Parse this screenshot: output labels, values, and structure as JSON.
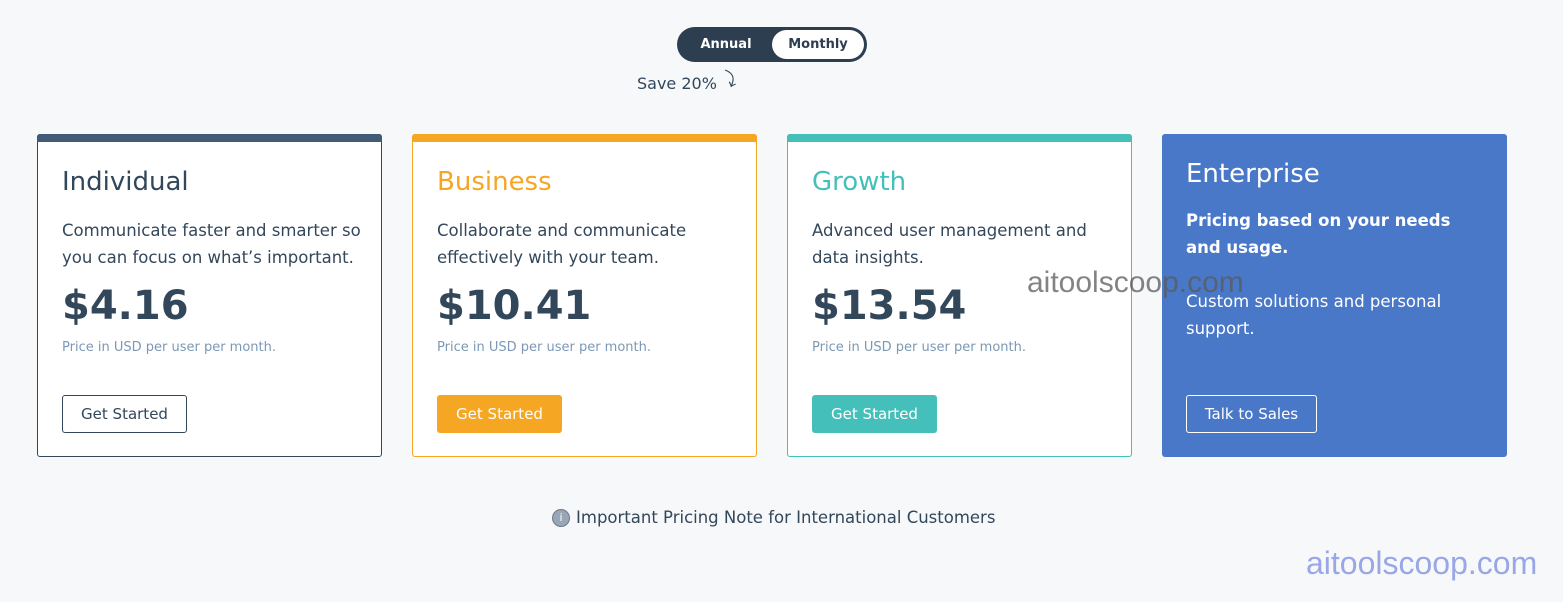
{
  "billing_toggle": {
    "annual": "Annual",
    "monthly": "Monthly",
    "savings": "Save 20%"
  },
  "plans": [
    {
      "name": "Individual",
      "description": "Communicate faster and smarter so you can focus on what’s important.",
      "price": "$4.16",
      "note": "Price in USD per user per month.",
      "cta": "Get Started",
      "accent": "#425b76"
    },
    {
      "name": "Business",
      "description": "Collaborate and communicate effectively with your team.",
      "price": "$10.41",
      "note": "Price in USD per user per month.",
      "cta": "Get Started",
      "accent": "#f5a623"
    },
    {
      "name": "Growth",
      "description": "Advanced user management and data insights.",
      "price": "$13.54",
      "note": "Price in USD per user per month.",
      "cta": "Get Started",
      "accent": "#45bfba"
    }
  ],
  "enterprise": {
    "name": "Enterprise",
    "lead": "Pricing based on your needs and usage.",
    "sub": "Custom solutions and personal support.",
    "cta": "Talk to Sales",
    "accent": "#4a78c8"
  },
  "intl_note": {
    "icon": "info-icon",
    "text": "Important Pricing Note for International Customers"
  },
  "watermarks": [
    "aitoolscoop.com",
    "aitoolscoop.com"
  ]
}
